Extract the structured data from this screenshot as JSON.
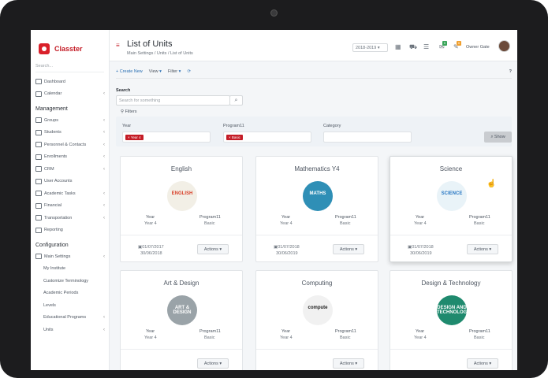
{
  "sidebar": {
    "brand": "Classter",
    "search_placeholder": "Search...",
    "top_items": [
      {
        "label": "Dashboard",
        "chevron": false
      },
      {
        "label": "Calendar",
        "chevron": true
      }
    ],
    "management_title": "Management",
    "management_items": [
      {
        "label": "Groups",
        "chevron": true
      },
      {
        "label": "Students",
        "chevron": true
      },
      {
        "label": "Personnel & Contacts",
        "chevron": true
      },
      {
        "label": "Enrollments",
        "chevron": true
      },
      {
        "label": "CRM",
        "chevron": true
      },
      {
        "label": "User Accounts",
        "chevron": false
      },
      {
        "label": "Academic Tasks",
        "chevron": true
      },
      {
        "label": "Financial",
        "chevron": true
      },
      {
        "label": "Transportation",
        "chevron": true
      },
      {
        "label": "Reporting",
        "chevron": false
      }
    ],
    "configuration_title": "Configuration",
    "config_items": [
      {
        "label": "Main Settings",
        "chevron": true,
        "sub": false
      },
      {
        "label": "My Institute",
        "chevron": false,
        "sub": true
      },
      {
        "label": "Customize Terminology",
        "chevron": false,
        "sub": true
      },
      {
        "label": "Academic Periods",
        "chevron": false,
        "sub": true
      },
      {
        "label": "Levels",
        "chevron": false,
        "sub": true
      },
      {
        "label": "Educational Programs",
        "chevron": true,
        "sub": true
      },
      {
        "label": "Units",
        "chevron": true,
        "sub": true
      }
    ]
  },
  "header": {
    "title": "List of Units",
    "breadcrumb": "Main Settings / Units / List of Units",
    "year": "2018-2019",
    "badge_green": "0",
    "badge_orange": "0",
    "owner": "Owner Gate"
  },
  "toolbar": {
    "create": "+ Create New",
    "view": "View",
    "filter": "Filter",
    "help": "?"
  },
  "search": {
    "label": "Search",
    "placeholder": "Search for something",
    "filters_label": "Filters"
  },
  "filters": {
    "year_label": "Year",
    "year_chip": "× Year 4",
    "program_label": "Program11",
    "program_chip": "× Basic",
    "category_label": "Category",
    "show_label": "Show"
  },
  "cards": [
    {
      "title": "English",
      "year_label": "Year",
      "year": "Year 4",
      "program_label": "Program11",
      "program": "Basic",
      "start": "01/07/2017",
      "end": "30/06/2018",
      "actions": "Actions",
      "thumb_text": "ENGLISH",
      "thumb_bg": "#f2efe6",
      "thumb_fg": "#d8402a",
      "active": false
    },
    {
      "title": "Mathematics Y4",
      "year_label": "Year",
      "year": "Year 4",
      "program_label": "Program11",
      "program": "Basic",
      "start": "01/07/2018",
      "end": "30/06/2019",
      "actions": "Actions",
      "thumb_text": "MATHS",
      "thumb_bg": "#2f8fb6",
      "thumb_fg": "#ffffff",
      "active": false
    },
    {
      "title": "Science",
      "year_label": "Year",
      "year": "Year 4",
      "program_label": "Program11",
      "program": "Basic",
      "start": "01/07/2018",
      "end": "30/06/2019",
      "actions": "Actions",
      "thumb_text": "SCIENCE",
      "thumb_bg": "#e9f3f8",
      "thumb_fg": "#2a78c4",
      "active": true
    },
    {
      "title": "Art & Design",
      "year_label": "Year",
      "year": "Year 4",
      "program_label": "Program11",
      "program": "Basic",
      "start": "",
      "end": "",
      "actions": "Actions",
      "thumb_text": "ART & DESIGN",
      "thumb_bg": "#9aa3a8",
      "thumb_fg": "#ffffff",
      "active": false
    },
    {
      "title": "Computing",
      "year_label": "Year",
      "year": "Year 4",
      "program_label": "Program11",
      "program": "Basic",
      "start": "",
      "end": "",
      "actions": "Actions",
      "thumb_text": "compute",
      "thumb_bg": "#f1f1f1",
      "thumb_fg": "#222222",
      "active": false
    },
    {
      "title": "Design & Technology",
      "year_label": "Year",
      "year": "Year 4",
      "program_label": "Program11",
      "program": "Basic",
      "start": "",
      "end": "",
      "actions": "Actions",
      "thumb_text": "DESIGN AND TECHNOLOGY",
      "thumb_bg": "#1f8a6e",
      "thumb_fg": "#ffffff",
      "active": false
    }
  ]
}
